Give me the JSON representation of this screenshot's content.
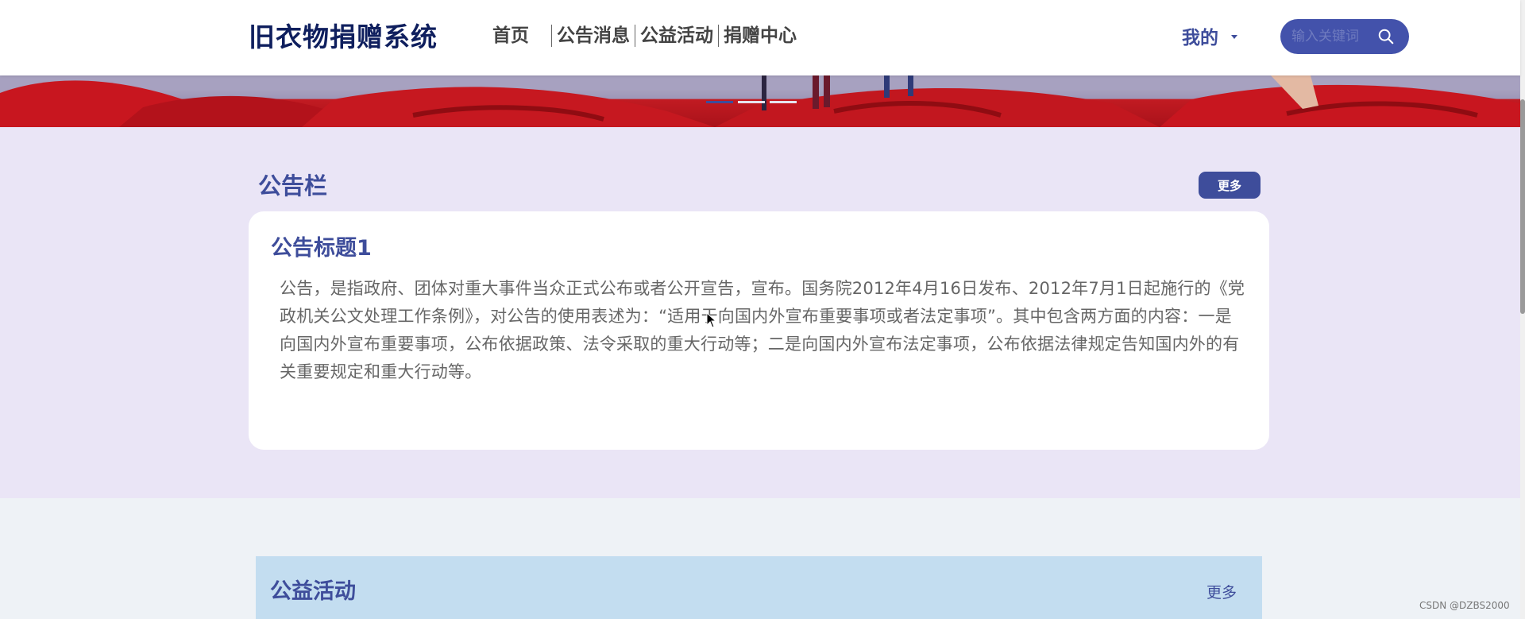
{
  "header": {
    "logo": "旧衣物捐赠系统",
    "nav": [
      "首页",
      "公告消息",
      "公益活动",
      "捐赠中心"
    ],
    "user_menu": "我的",
    "search_placeholder": "输入关键词"
  },
  "banner": {
    "slide_count": 3,
    "active_slide": 1
  },
  "notice": {
    "title": "公告栏",
    "more_label": "更多",
    "card_title": "公告标题1",
    "card_body": "公告，是指政府、团体对重大事件当众正式公布或者公开宣告，宣布。国务院2012年4月16日发布、2012年7月1日起施行的《党政机关公文处理工作条例》，对公告的使用表述为：“适用于向国内外宣布重要事项或者法定事项”。其中包含两方面的内容：一是向国内外宣布重要事项，公布依据政策、法令采取的重大行动等；二是向国内外宣布法定事项，公布依据法律规定告知国内外的有关重要规定和重大行动等。"
  },
  "activity": {
    "title": "公益活动",
    "more_label": "更多"
  },
  "watermark": "CSDN @DZBS2000",
  "colors": {
    "accent": "#3e4d9b",
    "logo": "#0f1f5e",
    "notice_bg": "#eae5f6",
    "activity_head_bg": "#c3ddf0",
    "banner_red": "#c21b22"
  }
}
